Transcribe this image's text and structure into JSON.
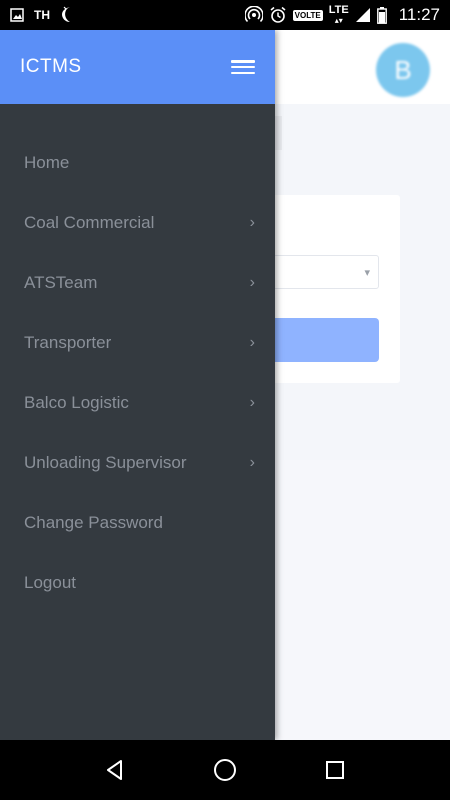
{
  "status_bar": {
    "carrier": "TH",
    "volte": "VOLTE",
    "network": "LTE",
    "time": "11:27",
    "icons": [
      "image-icon",
      "moon-icon",
      "hotspot-icon",
      "alarm-icon",
      "signal-icon",
      "battery-icon"
    ]
  },
  "drawer": {
    "title": "ICTMS",
    "header_color": "#5b8ff7",
    "background_color": "#343a40",
    "items": [
      {
        "label": "Home",
        "has_submenu": false
      },
      {
        "label": "Coal Commercial",
        "has_submenu": true
      },
      {
        "label": "ATSTeam",
        "has_submenu": true
      },
      {
        "label": "Transporter",
        "has_submenu": true
      },
      {
        "label": "Balco Logistic",
        "has_submenu": true
      },
      {
        "label": "Unloading Supervisor",
        "has_submenu": true
      },
      {
        "label": "Change Password",
        "has_submenu": false
      },
      {
        "label": "Logout",
        "has_submenu": false
      }
    ]
  },
  "background": {
    "avatar_letter": "B",
    "avatar_color": "#7cc7ee",
    "button_color": "#8fb3ff"
  },
  "nav_bar": {
    "icons": [
      "back-icon",
      "home-icon",
      "recents-icon"
    ]
  }
}
